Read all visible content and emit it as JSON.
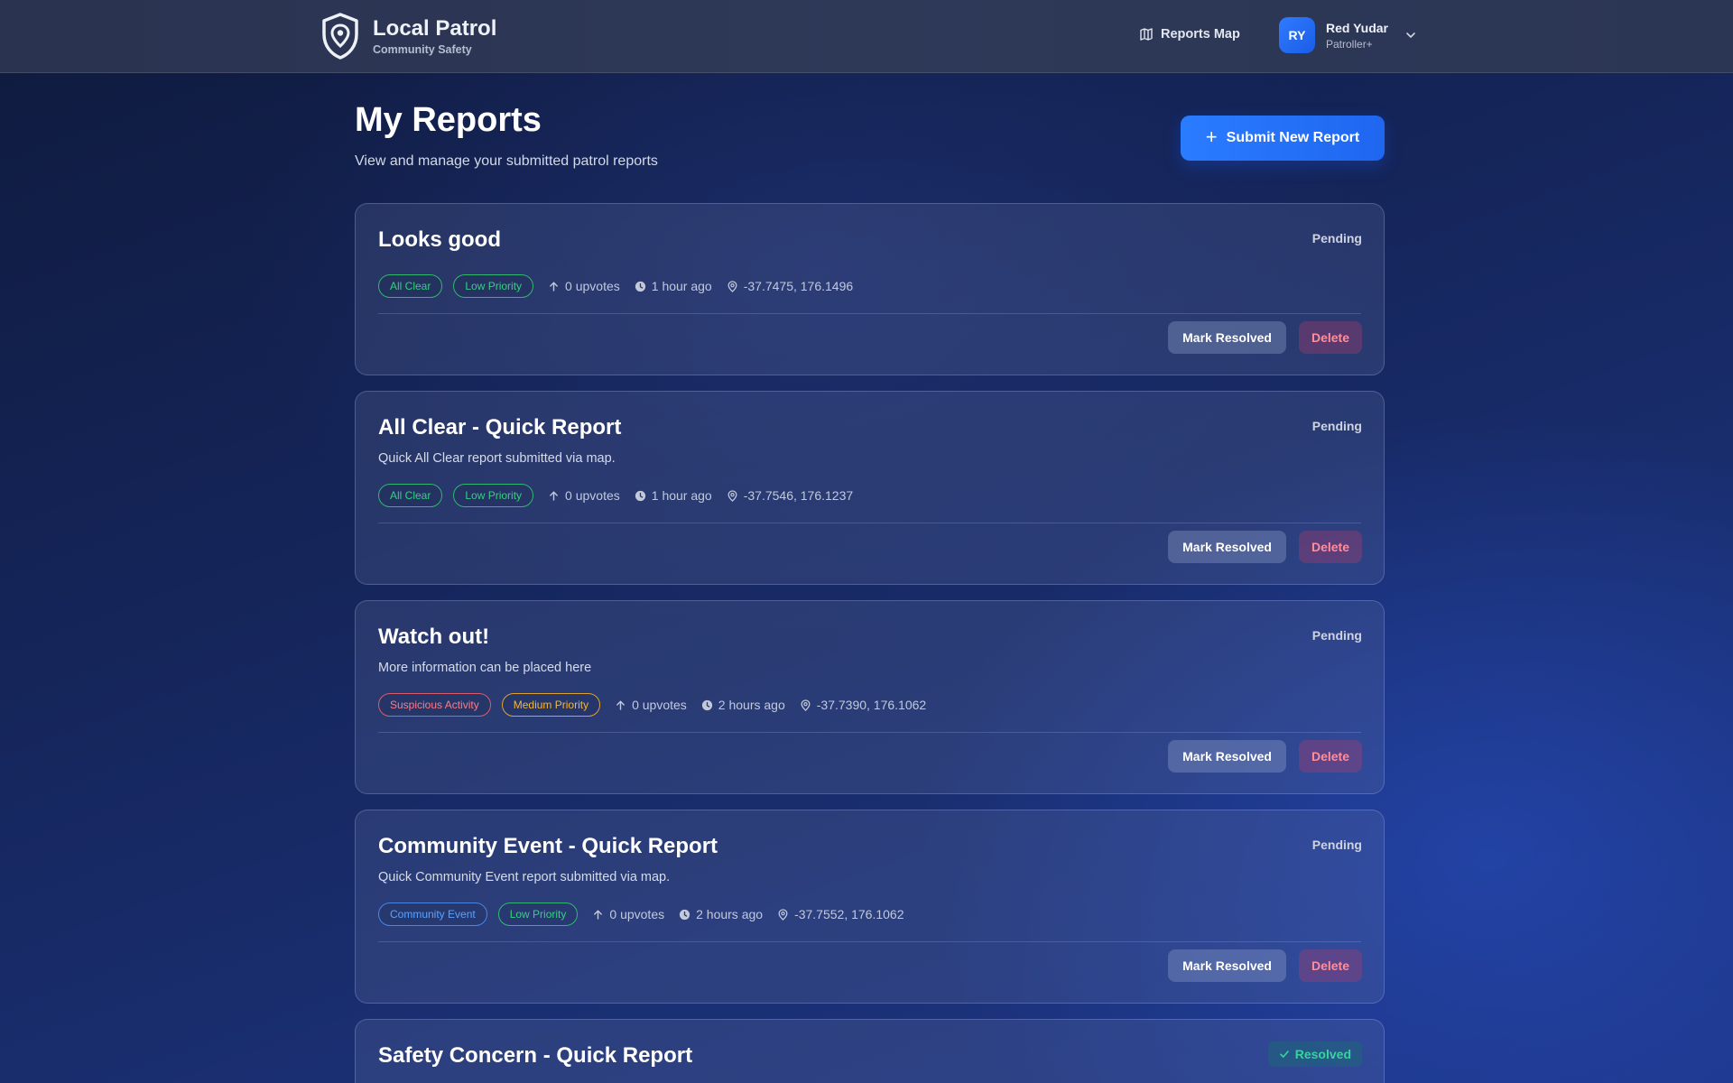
{
  "app": {
    "title": "Local Patrol",
    "subtitle": "Community Safety"
  },
  "nav": {
    "reports_map": "Reports Map"
  },
  "user": {
    "initials": "RY",
    "name": "Red Yudar",
    "role": "Patroller+"
  },
  "page": {
    "title": "My Reports",
    "subtitle": "View and manage your submitted patrol reports",
    "submit_label": "Submit New Report"
  },
  "actions": {
    "resolve_label": "Mark Resolved",
    "delete_label": "Delete"
  },
  "colors": {
    "accent": "#2a7cff",
    "all_clear": "#35d07f",
    "suspicious": "#ff7a85",
    "medium_priority": "#f5b63a",
    "community_event": "#5aa2ff",
    "resolved": "#3ad1a0"
  },
  "reports": [
    {
      "title": "Looks good",
      "description": "",
      "status": "Pending",
      "category": "All Clear",
      "priority": "Low Priority",
      "upvotes": "0 upvotes",
      "time": "1 hour ago",
      "coords": "-37.7475, 176.1496"
    },
    {
      "title": "All Clear - Quick Report",
      "description": "Quick All Clear report submitted via map.",
      "status": "Pending",
      "category": "All Clear",
      "priority": "Low Priority",
      "upvotes": "0 upvotes",
      "time": "1 hour ago",
      "coords": "-37.7546, 176.1237"
    },
    {
      "title": "Watch out!",
      "description": "More information can be placed here",
      "status": "Pending",
      "category": "Suspicious Activity",
      "priority": "Medium Priority",
      "upvotes": "0 upvotes",
      "time": "2 hours ago",
      "coords": "-37.7390, 176.1062"
    },
    {
      "title": "Community Event - Quick Report",
      "description": "Quick Community Event report submitted via map.",
      "status": "Pending",
      "category": "Community Event",
      "priority": "Low Priority",
      "upvotes": "0 upvotes",
      "time": "2 hours ago",
      "coords": "-37.7552, 176.1062"
    },
    {
      "title": "Safety Concern - Quick Report",
      "status": "Resolved"
    }
  ]
}
